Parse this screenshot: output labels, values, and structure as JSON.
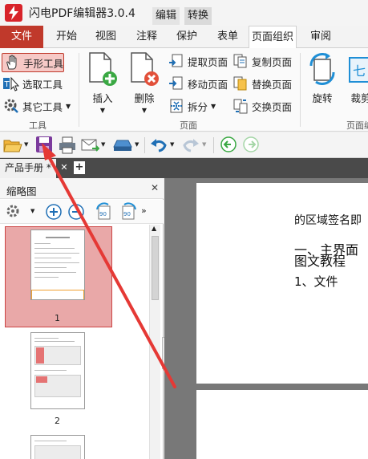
{
  "app": {
    "title": "闪电PDF编辑器3.0.4",
    "mode_tabs": [
      "编辑",
      "转换"
    ]
  },
  "menubar": {
    "file": "文件",
    "tabs": [
      "开始",
      "视图",
      "注释",
      "保护",
      "表单",
      "页面组织",
      "审阅"
    ],
    "active": "页面组织"
  },
  "ribbon": {
    "tools_group": {
      "label": "工具",
      "hand_tool": "手形工具",
      "select_tool": "选取工具",
      "other_tools": "其它工具"
    },
    "page_group": {
      "label": "页面",
      "insert": "插入",
      "delete": "删除",
      "extract": "提取页面",
      "move": "移动页面",
      "split": "拆分",
      "copy": "复制页面",
      "replace": "替换页面",
      "swap": "交换页面"
    },
    "rotate": "旋转",
    "crop": "裁剪",
    "page_partial_label": "页面编"
  },
  "doc_tab": {
    "name": "产品手册 *"
  },
  "thumbnails": {
    "title": "缩略图",
    "pages": [
      "1",
      "2"
    ]
  },
  "page_content": {
    "line1": "的区域签名即",
    "line2": "一、主界面",
    "line3": "图文教程",
    "line4": "1、文件"
  },
  "colors": {
    "accent": "#c0392b",
    "selection": "#e9a8a8",
    "doc_bg": "#787878",
    "arrow": "#e53935"
  }
}
